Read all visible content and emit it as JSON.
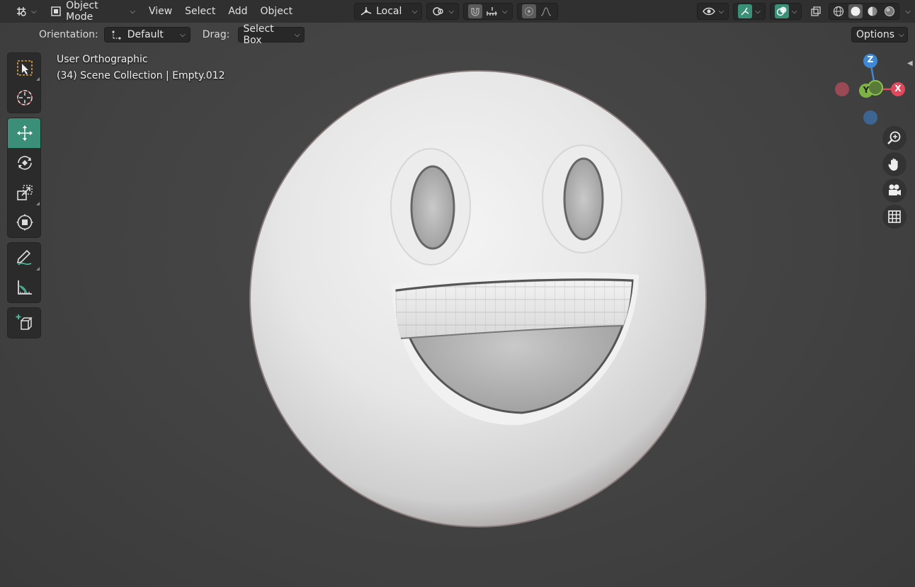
{
  "header": {
    "editor_type_icon": "viewport-grid-icon",
    "mode": "Object Mode",
    "menus": [
      "View",
      "Select",
      "Add",
      "Object"
    ],
    "transform_orientation": "Local",
    "options_label": "Options"
  },
  "tool_settings": {
    "orientation_label": "Orientation:",
    "orientation_value": "Default",
    "drag_label": "Drag:",
    "drag_value": "Select Box"
  },
  "viewport": {
    "view_name": "User Orthographic",
    "collection_info": "(34) Scene Collection | Empty.012"
  },
  "gizmo": {
    "axes": [
      "Z",
      "Y",
      "X"
    ]
  },
  "tools": [
    "select-box",
    "cursor",
    "move",
    "rotate",
    "scale",
    "transform",
    "annotate",
    "measure",
    "add-cube"
  ],
  "colors": {
    "accent": "#3b8e78",
    "x_axis": "#e3475c",
    "y_axis": "#8bc34a",
    "z_axis": "#3f88d6"
  }
}
